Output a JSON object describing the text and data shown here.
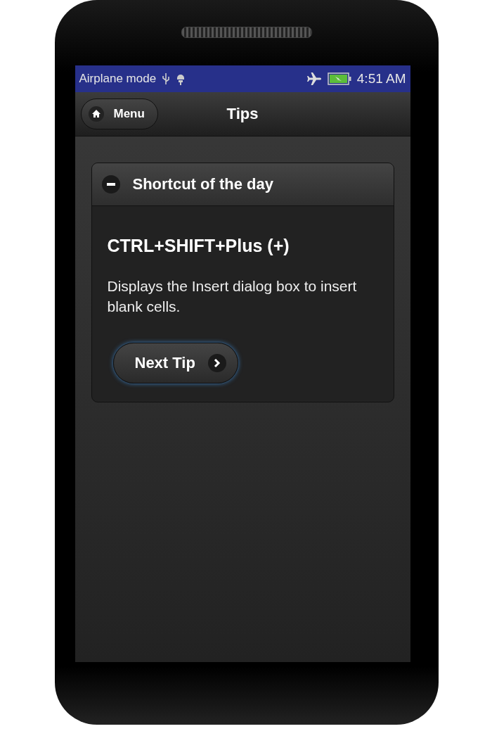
{
  "status_bar": {
    "mode": "Airplane mode",
    "time": "4:51 AM",
    "battery_charging": true
  },
  "header": {
    "menu_button": "Menu",
    "title": "Tips"
  },
  "panel": {
    "title": "Shortcut of the day",
    "expanded": true,
    "shortcut": "CTRL+SHIFT+Plus (+)",
    "description": "Displays the Insert dialog box to insert blank cells.",
    "next_button": "Next Tip"
  }
}
